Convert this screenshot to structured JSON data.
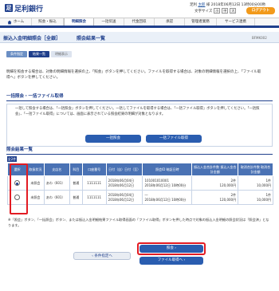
{
  "header": {
    "logo_mark": "足",
    "logo_text": "足利銀行",
    "user_prefix": "足利",
    "user_name": "太郎",
    "user_suffix": "様 2018年06月12日 13時00分00秒",
    "font_size_label": "文字サイズ",
    "font_small": "小",
    "font_medium": "中",
    "font_large": "大",
    "logout_label": "ログアウト"
  },
  "nav": {
    "home_label": "ホーム",
    "items": [
      "照会・振込",
      "明細照会",
      "一括伝送",
      "代金回収",
      "承認",
      "管理者業務",
      "サービス連携"
    ]
  },
  "page": {
    "title": "振込入金明細照会［全銀］",
    "subtitle": "照会結果一覧",
    "page_id": "BFMK002"
  },
  "steps": [
    "条件指定",
    "結果一覧",
    "明細表示"
  ],
  "intro": "明細を照会する場合は、対象の明細情報を選択の上、「照会」ボタンを押してください。ファイルを取得する場合は、対象の明細情報を選択の上、「ファイル取得へ」ボタンを押してください。",
  "bulk": {
    "title": "一括照会・一括ファイル取得",
    "text": "一括して照会する場合は、「一括照会」ボタンを押してください。一括してファイルを取得する場合は、「一括ファイル取得」ボタンを押してください。「一括照会」、「一括ファイル取得」については、画面に表示されている照会結果の明細が対象となります。",
    "btn_bulk_inquiry": "一括照会",
    "btn_bulk_file": "一括ファイル取得"
  },
  "results": {
    "title": "照会結果一覧",
    "count_tag": "全2件",
    "headers": [
      "選択",
      "取扱状況",
      "支店名",
      "科目",
      "口座番号",
      "日付（自）日付（至）",
      "照会ID 暗証日時",
      "振込入金合計件数 振込入金合計金額",
      "取消合計件数 取消合計金額"
    ],
    "rows": [
      {
        "selected": true,
        "status": "未照会",
        "branch": "あわ（601）",
        "subject": "普通",
        "account": "1111111",
        "date_from": "2018年06月04日",
        "date_to": "2018年06月12日",
        "inquiry_id": "101001010001",
        "inquiry_time": "2018年06月12日 10時00分",
        "total_count": "2件",
        "total_amount": "120,000円",
        "cancel_count": "1件",
        "cancel_amount": "10,000円"
      },
      {
        "selected": false,
        "status": "未照会",
        "branch": "あわ（601）",
        "subject": "普通",
        "account": "1111111",
        "date_from": "2018年06月04日",
        "date_to": "2018年06月12日",
        "inquiry_id": "―",
        "inquiry_time": "2018年06月12日 10時00分",
        "total_count": "2件",
        "total_amount": "120,000円",
        "cancel_count": "1件",
        "cancel_amount": "10,000円"
      }
    ],
    "note": "※「照会」ボタン、「一括照会」ボタン、または振込入金明細結果ファイル取得画面の「ファイル取得」ボタンを押した時点で対象の振込入金明細の照会状況は「照会済」となります。"
  },
  "footer": {
    "back_label": "条件指定へ",
    "inquiry_label": "照会",
    "file_label": "ファイル取得へ"
  }
}
